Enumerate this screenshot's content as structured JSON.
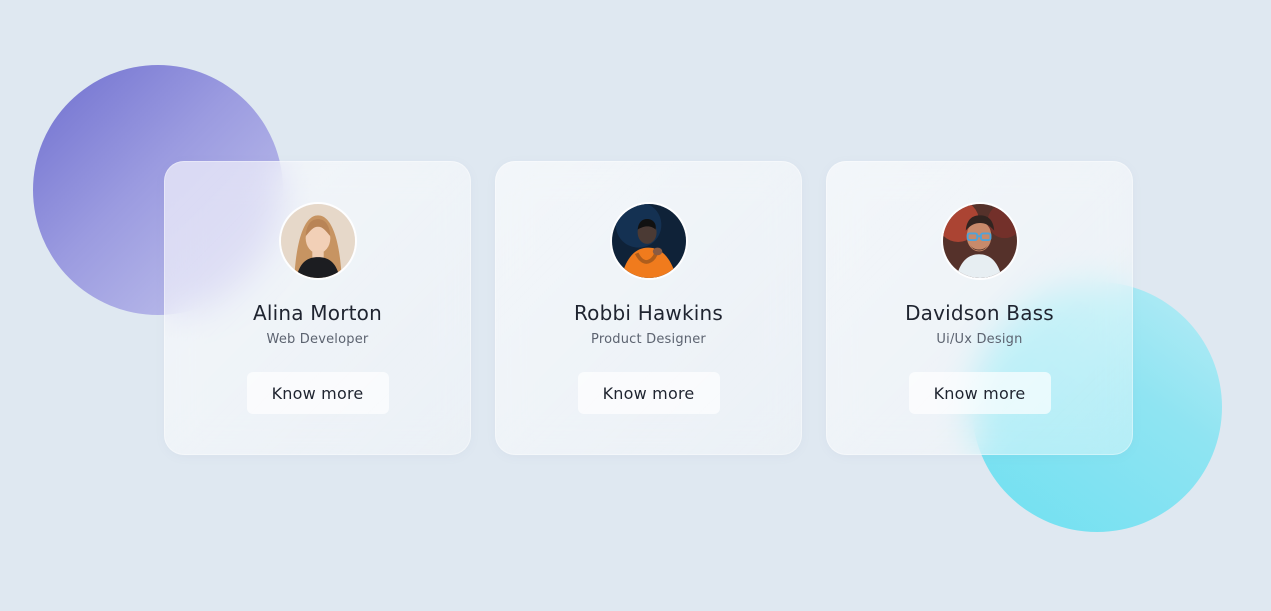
{
  "cards": [
    {
      "name": "Alina Morton",
      "role": "Web Developer",
      "button_label": "Know more"
    },
    {
      "name": "Robbi Hawkins",
      "role": "Product Designer",
      "button_label": "Know more"
    },
    {
      "name": "Davidson Bass",
      "role": "Ui/Ux Design",
      "button_label": "Know more"
    }
  ],
  "colors": {
    "background": "#dfe8f1",
    "purple_blob": "#7b7bd3",
    "cyan_blob": "#7fe2f1",
    "text_primary": "#1f2430",
    "text_secondary": "#5c6370"
  }
}
